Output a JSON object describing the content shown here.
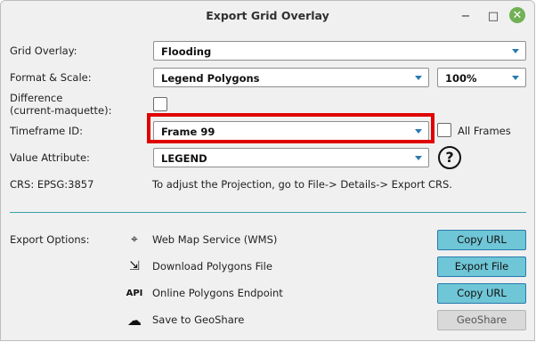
{
  "window": {
    "title": "Export Grid Overlay",
    "controls": {
      "minimize": "−",
      "maximize": "□",
      "close": "✕"
    }
  },
  "fields": {
    "grid_overlay": {
      "label": "Grid Overlay:",
      "value": "Flooding"
    },
    "format_scale": {
      "label": "Format & Scale:",
      "value": "Legend Polygons",
      "scale": "100%"
    },
    "difference": {
      "label_line1": "Difference",
      "label_line2": "(current-maquette):",
      "checked": false
    },
    "timeframe": {
      "label": "Timeframe ID:",
      "value": "Frame 99",
      "all_frames_label": "All Frames",
      "all_frames_checked": false
    },
    "value_attribute": {
      "label": "Value Attribute:",
      "value": "LEGEND",
      "help": "?"
    },
    "crs": {
      "label": "CRS: EPSG:3857",
      "hint": "To adjust the Projection, go to File-> Details-> Export CRS."
    }
  },
  "export": {
    "label": "Export Options:",
    "options": [
      {
        "icon": "map-pin-icon",
        "glyph": "⌖",
        "label": "Web Map Service (WMS)",
        "button": "Copy URL",
        "enabled": true
      },
      {
        "icon": "download-file-icon",
        "glyph": "⇲",
        "label": "Download Polygons File",
        "button": "Export File",
        "enabled": true
      },
      {
        "icon": "api-icon",
        "glyph": "API",
        "label": "Online Polygons Endpoint",
        "button": "Copy URL",
        "enabled": true
      },
      {
        "icon": "cloud-upload-icon",
        "glyph": "☁",
        "label": "Save to GeoShare",
        "button": "GeoShare",
        "enabled": false
      }
    ]
  },
  "colors": {
    "accent": "#6fc6d6",
    "separator": "#3aa3a8",
    "highlight": "#e00000",
    "close_button": "#72b055"
  }
}
